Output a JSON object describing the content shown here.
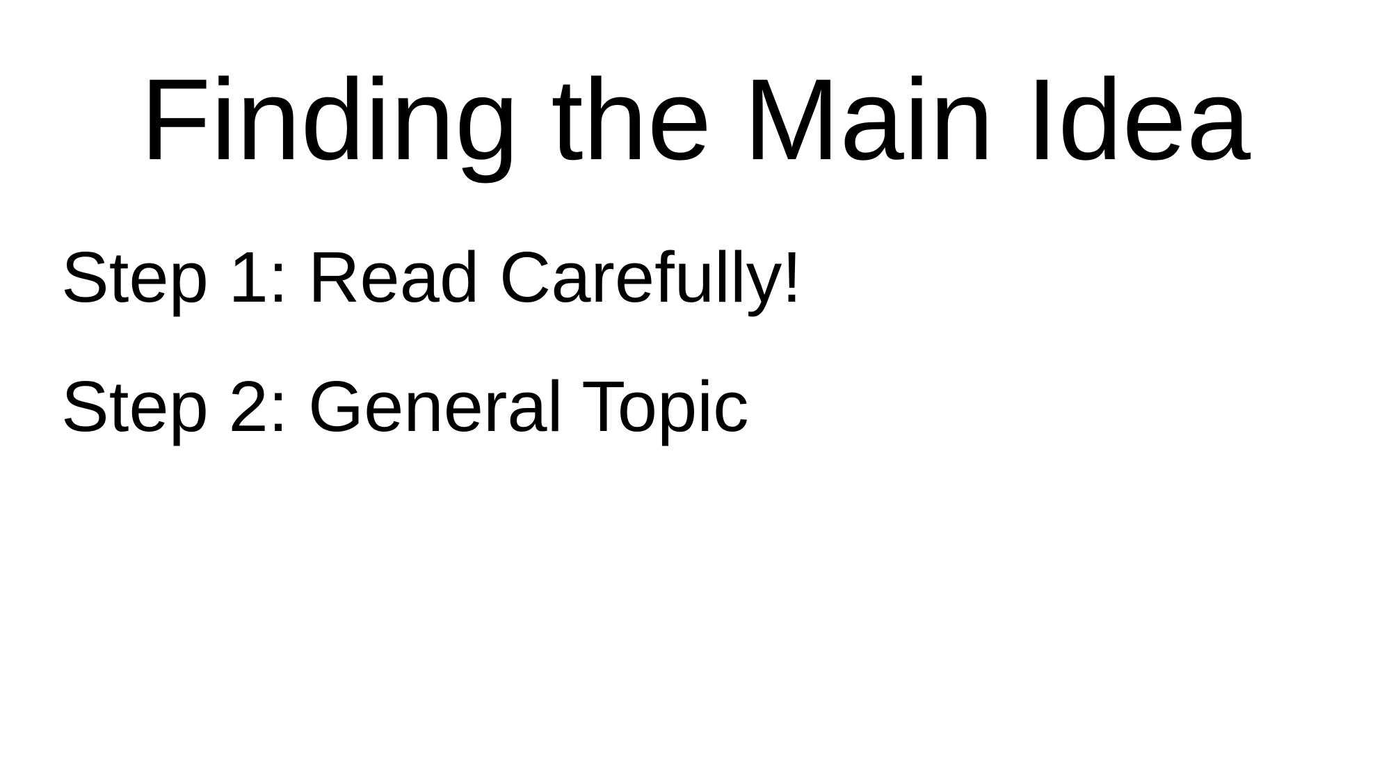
{
  "slide": {
    "title": "Finding the Main Idea",
    "steps": [
      {
        "label": "Step 1: Read Carefully!"
      },
      {
        "label": "Step 2: General Topic"
      }
    ]
  }
}
